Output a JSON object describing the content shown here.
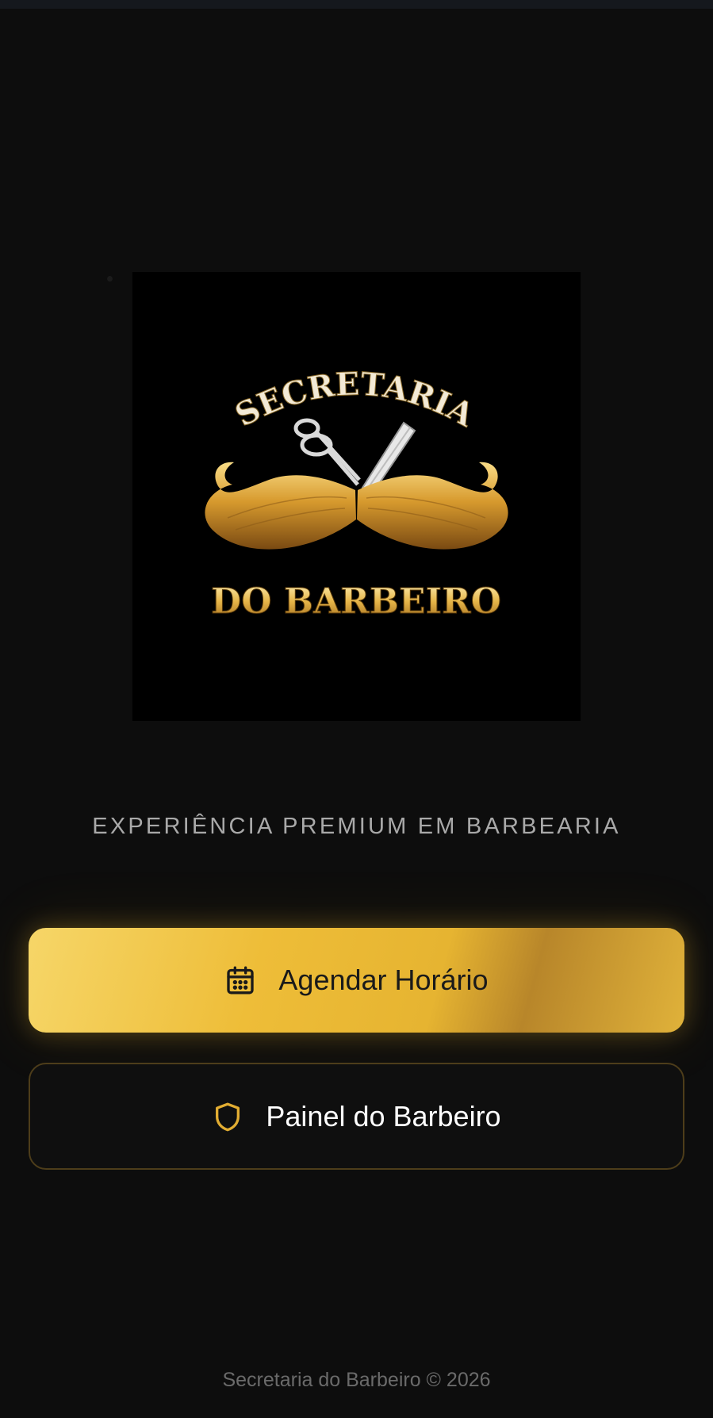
{
  "logo": {
    "text_top": "SECRETARIA",
    "text_bottom": "DO BARBEIRO"
  },
  "tagline": "EXPERIÊNCIA PREMIUM EM BARBEARIA",
  "buttons": {
    "schedule": {
      "label": "Agendar Horário",
      "icon": "calendar-icon"
    },
    "barber_panel": {
      "label": "Painel do Barbeiro",
      "icon": "shield-icon"
    }
  },
  "footer": "Secretaria do Barbeiro © 2026",
  "colors": {
    "background": "#0d0d0d",
    "gold": "#eebd38",
    "gold_border": "#4d3d1a",
    "tagline": "#a9a9a9",
    "footer": "#6a6a6a"
  }
}
